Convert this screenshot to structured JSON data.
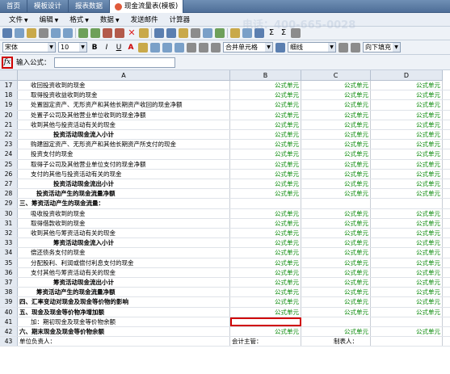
{
  "tabs": [
    {
      "label": "首页",
      "active": false
    },
    {
      "label": "模板设计",
      "active": false
    },
    {
      "label": "报表数据",
      "active": false
    },
    {
      "label": "现金流量表(模板)",
      "active": true
    }
  ],
  "watermark": "电话：400-665-0028",
  "menus": [
    {
      "label": "文件"
    },
    {
      "label": "编辑"
    },
    {
      "label": "格式"
    },
    {
      "label": "数据"
    },
    {
      "label": "发送邮件"
    },
    {
      "label": "计算器"
    }
  ],
  "format": {
    "font_name": "宋体",
    "font_size": "10",
    "merge": "合并单元格",
    "line_style": "细线",
    "fill": "向下填充"
  },
  "formula": {
    "label": "输入公式：",
    "value": ""
  },
  "columns": [
    "A",
    "B",
    "C",
    "D"
  ],
  "formula_cell_label": "公式单元",
  "rows": [
    {
      "n": "17",
      "a": "收回投资收到的现金",
      "indent": 2,
      "bold": false,
      "formula": true
    },
    {
      "n": "18",
      "a": "取得投资收益收到的现金",
      "indent": 2,
      "bold": false,
      "formula": true
    },
    {
      "n": "19",
      "a": "处置固定资产、无形资产和其他长期资产收回的现金净额",
      "indent": 2,
      "bold": false,
      "formula": true
    },
    {
      "n": "20",
      "a": "处置子公司及其他营业单位收到的现金净额",
      "indent": 2,
      "bold": false,
      "formula": true
    },
    {
      "n": "21",
      "a": "收到其他与投资活动有关的现金",
      "indent": 2,
      "bold": false,
      "formula": true
    },
    {
      "n": "22",
      "a": "投资活动现金流入小计",
      "indent": 6,
      "bold": true,
      "formula": true
    },
    {
      "n": "23",
      "a": "购建固定资产、无形资产和其他长期资产所支付的现金",
      "indent": 2,
      "bold": false,
      "formula": true
    },
    {
      "n": "24",
      "a": "投资支付的现金",
      "indent": 2,
      "bold": false,
      "formula": true
    },
    {
      "n": "25",
      "a": "取得子公司及其他营业单位支付的现金净额",
      "indent": 2,
      "bold": false,
      "formula": true
    },
    {
      "n": "26",
      "a": "支付的其他与投资活动有关的现金",
      "indent": 2,
      "bold": false,
      "formula": true
    },
    {
      "n": "27",
      "a": "投资活动现金流出小计",
      "indent": 6,
      "bold": true,
      "formula": true
    },
    {
      "n": "28",
      "a": "投资活动产生的现金流量净额",
      "indent": 3,
      "bold": true,
      "formula": true
    },
    {
      "n": "29",
      "a": "三、筹资活动产生的现金流量：",
      "indent": 0,
      "bold": true,
      "formula": false
    },
    {
      "n": "30",
      "a": "吸收投资收到的现金",
      "indent": 2,
      "bold": false,
      "formula": true
    },
    {
      "n": "31",
      "a": "取得借款收到的现金",
      "indent": 2,
      "bold": false,
      "formula": true
    },
    {
      "n": "32",
      "a": "收到其他与筹资活动有关的现金",
      "indent": 2,
      "bold": false,
      "formula": true
    },
    {
      "n": "33",
      "a": "筹资活动现金流入小计",
      "indent": 6,
      "bold": true,
      "formula": true
    },
    {
      "n": "34",
      "a": "偿还债务支付的现金",
      "indent": 2,
      "bold": false,
      "formula": true
    },
    {
      "n": "35",
      "a": "分配股利、利润或偿付利息支付的现金",
      "indent": 2,
      "bold": false,
      "formula": true
    },
    {
      "n": "36",
      "a": "支付其他与筹资活动有关的现金",
      "indent": 2,
      "bold": false,
      "formula": true
    },
    {
      "n": "37",
      "a": "筹资活动现金流出小计",
      "indent": 6,
      "bold": true,
      "formula": true
    },
    {
      "n": "38",
      "a": "筹资活动产生的现金流量净额",
      "indent": 3,
      "bold": true,
      "formula": true
    },
    {
      "n": "39",
      "a": "四、汇率变动对现金及现金等价物的影响",
      "indent": 0,
      "bold": true,
      "formula": true
    },
    {
      "n": "40",
      "a": "五、现金及现金等价物净增加额",
      "indent": 0,
      "bold": true,
      "formula": true
    },
    {
      "n": "41",
      "a": "加：期初现金及现金等价物余额",
      "indent": 2,
      "bold": false,
      "formula": false,
      "selected": true
    },
    {
      "n": "42",
      "a": "六、期末现金及现金等价物余额",
      "indent": 0,
      "bold": true,
      "formula": true
    },
    {
      "n": "43",
      "a": "单位负责人：",
      "indent": 0,
      "bold": false,
      "formula": false,
      "footer": true
    }
  ],
  "footer": {
    "accountant": "会计主管：",
    "preparer": "制表人："
  }
}
